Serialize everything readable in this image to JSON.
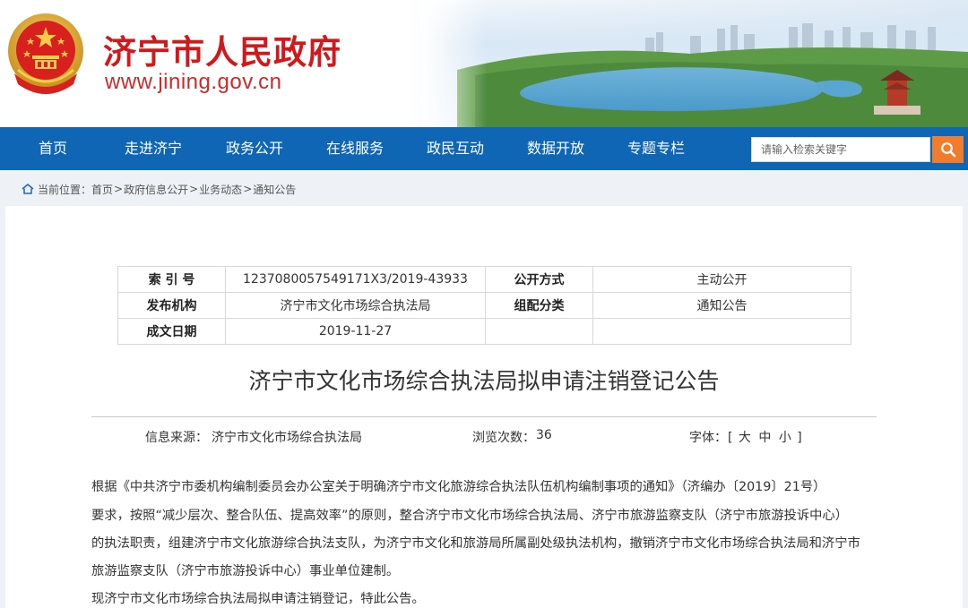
{
  "header": {
    "site_title": "济宁市人民政府",
    "site_url": "www.jining.gov.cn"
  },
  "nav": {
    "items": [
      "首页",
      "走进济宁",
      "政务公开",
      "在线服务",
      "政民互动",
      "数据开放",
      "专题专栏"
    ]
  },
  "search": {
    "placeholder": "请输入检索关键字"
  },
  "breadcrumb": {
    "label": "当前位置：",
    "items": [
      "首页",
      "政府信息公开",
      "业务动态",
      "通知公告"
    ],
    "separator": ">"
  },
  "meta": {
    "index_label": "索  引  号",
    "index_value": "1237080057549171X3/2019-43933",
    "disclosure_label": "公开方式",
    "disclosure_value": "主动公开",
    "publisher_label": "发布机构",
    "publisher_value": "济宁市文化市场综合执法局",
    "category_label": "组配分类",
    "category_value": "通知公告",
    "date_label": "成文日期",
    "date_value": "2019-11-27"
  },
  "article": {
    "title": "济宁市文化市场综合执法局拟申请注销登记公告",
    "source_label": "信息来源：",
    "source_value": "济宁市文化市场综合执法局",
    "views_label": "浏览次数：",
    "views_value": "36",
    "font_label": "字体：",
    "font_open": "[",
    "font_large": "大",
    "font_medium": "中",
    "font_small": "小",
    "font_close": "]",
    "lines": [
      "    根据《中共济宁市委机构编制委员会办公室关于明确济宁市文化旅游综合执法队伍机构编制事项的通知》（济编办〔2019〕21号）",
      "要求，按照“减少层次、整合队伍、提高效率”的原则，整合济宁市文化市场综合执法局、济宁市旅游监察支队（济宁市旅游投诉中心）",
      "的执法职责，组建济宁市文化旅游综合执法支队，为济宁市文化和旅游局所属副处级执法机构，撤销济宁市文化市场综合执法局和济宁市",
      "旅游监察支队（济宁市旅游投诉中心）事业单位建制。",
      "    现济宁市文化市场综合执法局拟申请注销登记，特此公告。"
    ]
  },
  "colors": {
    "nav_bg": "#0e66b4",
    "title_red": "#d3181c",
    "search_button": "#f07c2c"
  }
}
